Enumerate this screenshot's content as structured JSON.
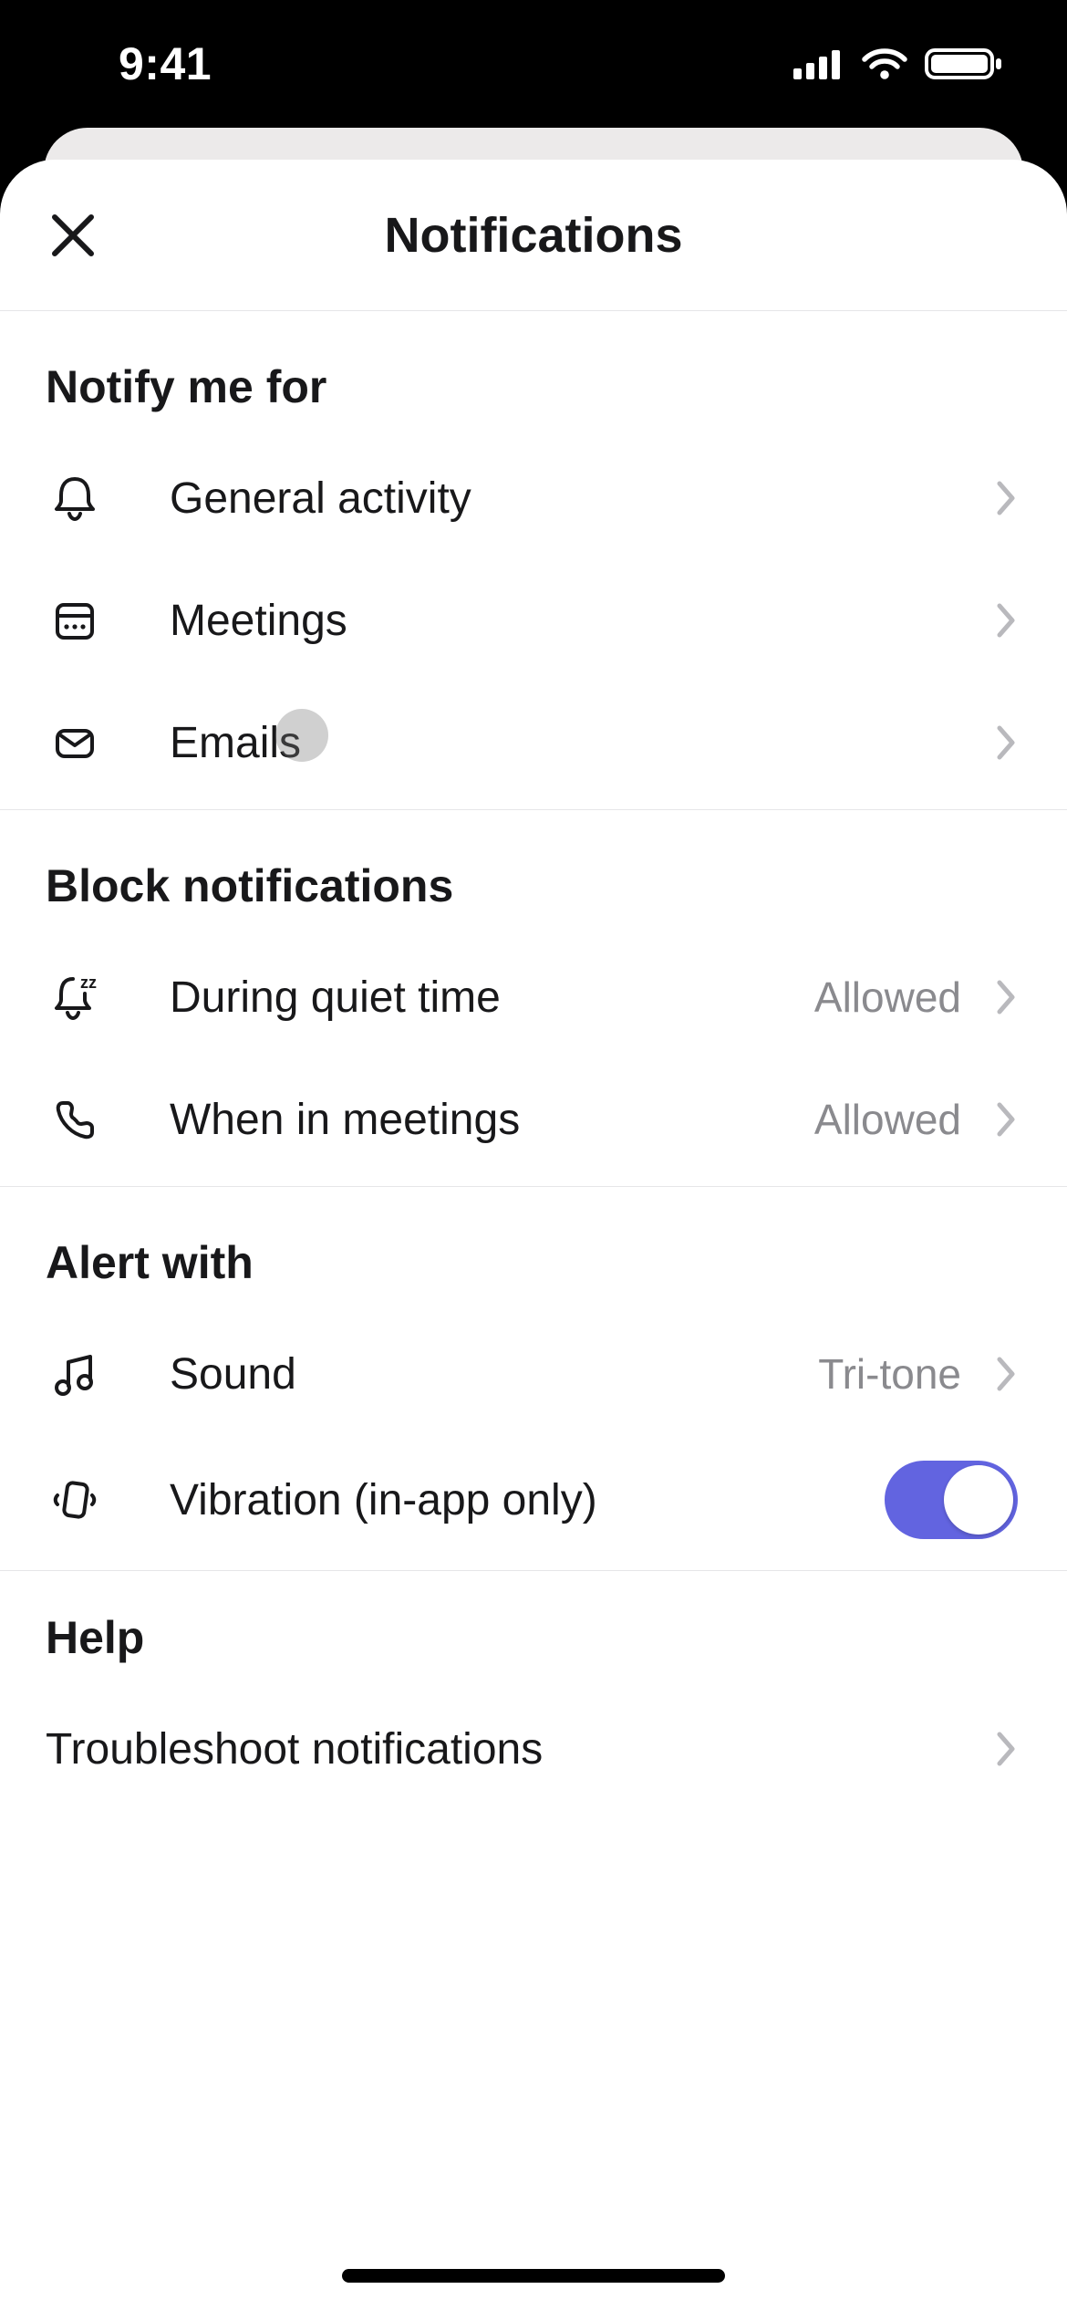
{
  "statusbar": {
    "time": "9:41"
  },
  "header": {
    "title": "Notifications"
  },
  "sections": {
    "notify": {
      "title": "Notify me for",
      "items": {
        "general_activity": {
          "label": "General activity"
        },
        "meetings": {
          "label": "Meetings"
        },
        "emails": {
          "label": "Emails"
        }
      }
    },
    "block": {
      "title": "Block notifications",
      "items": {
        "quiet_time": {
          "label": "During quiet time",
          "value": "Allowed"
        },
        "when_in_meetings": {
          "label": "When in meetings",
          "value": "Allowed"
        }
      }
    },
    "alert": {
      "title": "Alert with",
      "items": {
        "sound": {
          "label": "Sound",
          "value": "Tri-tone"
        },
        "vibration": {
          "label": "Vibration (in-app only)",
          "on": true
        }
      }
    },
    "help": {
      "title": "Help",
      "items": {
        "troubleshoot": {
          "label": "Troubleshoot notifications"
        }
      }
    }
  }
}
